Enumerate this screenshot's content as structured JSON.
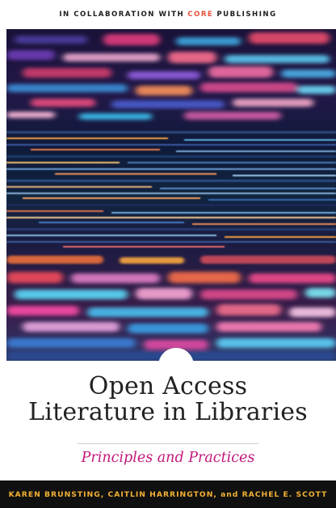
{
  "cover": {
    "collab_prefix": "IN COLLABORATION WITH",
    "collab_brand": "CORE",
    "collab_suffix": "PUBLISHING",
    "title_line1": "Open Access",
    "title_line2": "Literature in Libraries",
    "subtitle": "Principles and Practices",
    "authors": "KAREN BRUNSTING, CAITLIN HARRINGTON, and RACHEL E. SCOTT"
  },
  "colors": {
    "brand_accent": "#e8503a",
    "subtitle": "#c2187a",
    "author_bar_bg": "#101010",
    "author_text": "#f2b134"
  }
}
